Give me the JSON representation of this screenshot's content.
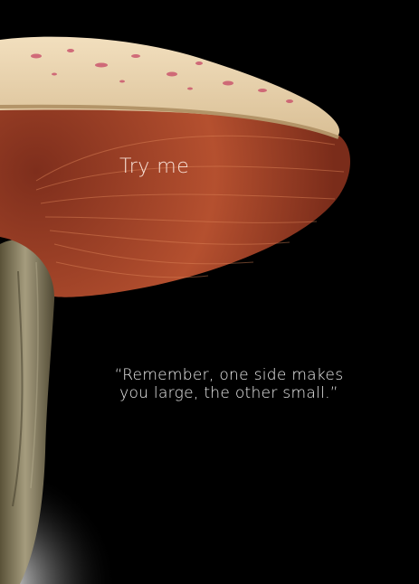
{
  "hero": {
    "tagline": "Try me",
    "quote_line_1": "“Remember, one side makes",
    "quote_line_2": "you large, the other small.”"
  },
  "colors": {
    "background": "#000000",
    "cap_top": "#e9d2b0",
    "cap_spots": "#c9506a",
    "gills": "#a8452a",
    "stem": "#a49a7c"
  }
}
